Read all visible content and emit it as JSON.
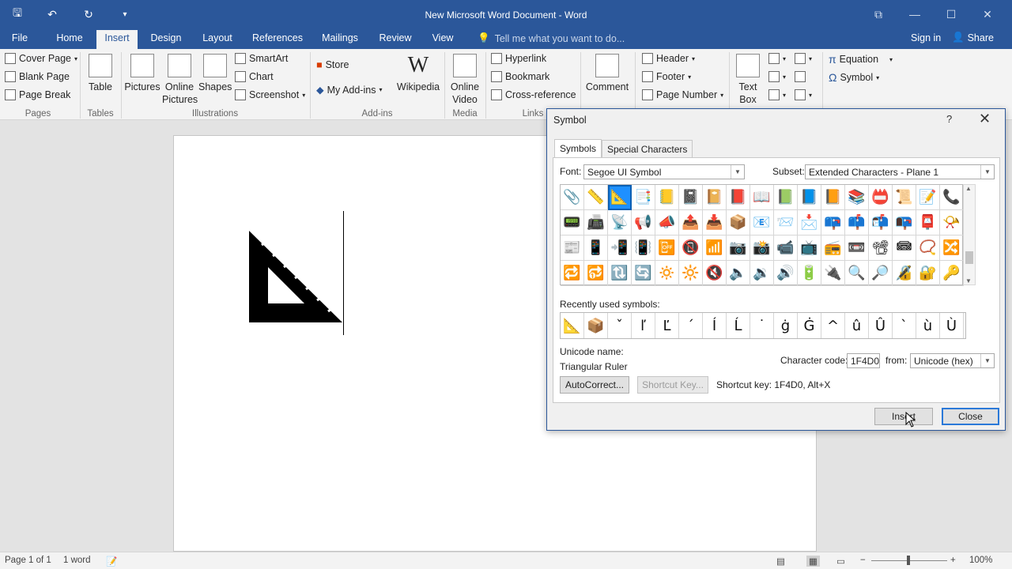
{
  "window": {
    "title": "New Microsoft Word Document - Word"
  },
  "qat": {
    "save_icon": "save-icon",
    "undo_icon": "undo-icon",
    "redo_icon": "redo-icon",
    "save_glyph": "🖫",
    "undo_glyph": "↶",
    "redo_glyph": "↻",
    "customize_glyph": "▾"
  },
  "window_controls": {
    "restore_ribbon": "⧉",
    "minimize": "—",
    "maximize": "☐",
    "close": "✕"
  },
  "menu": {
    "tabs": [
      "File",
      "Home",
      "Insert",
      "Design",
      "Layout",
      "References",
      "Mailings",
      "Review",
      "View"
    ],
    "active": "Insert",
    "tell_me": "Tell me what you want to do...",
    "sign_in": "Sign in",
    "share": "Share"
  },
  "ribbon": {
    "pages": {
      "cover_page": "Cover Page",
      "blank_page": "Blank Page",
      "page_break": "Page Break",
      "group": "Pages"
    },
    "tables": {
      "table": "Table",
      "group": "Tables"
    },
    "illustrations": {
      "pictures": "Pictures",
      "online_pictures_1": "Online",
      "online_pictures_2": "Pictures",
      "shapes": "Shapes",
      "smartart": "SmartArt",
      "chart": "Chart",
      "screenshot": "Screenshot",
      "group": "Illustrations"
    },
    "addins": {
      "store": "Store",
      "my_addins": "My Add-ins",
      "wikipedia": "Wikipedia",
      "group": "Add-ins"
    },
    "media": {
      "online_video_1": "Online",
      "online_video_2": "Video",
      "group": "Media"
    },
    "links": {
      "hyperlink": "Hyperlink",
      "bookmark": "Bookmark",
      "cross_reference": "Cross-reference",
      "group": "Links"
    },
    "comments": {
      "comment": "Comment"
    },
    "header_footer": {
      "header": "Header",
      "footer": "Footer",
      "page_number": "Page Number"
    },
    "text": {
      "text_box_1": "Text",
      "text_box_2": "Box"
    },
    "symbols": {
      "equation": "Equation",
      "symbol": "Symbol"
    }
  },
  "dialog": {
    "title": "Symbol",
    "help": "?",
    "close_glyph": "✕",
    "tabs": [
      "Symbols",
      "Special Characters"
    ],
    "active_tab": "Symbols",
    "font_label": "Font:",
    "font_value": "Segoe UI Symbol",
    "subset_label": "Subset:",
    "subset_value": "Extended Characters - Plane 1",
    "symbols": [
      [
        "📎",
        "📏",
        "📐",
        "📑",
        "📒",
        "📓",
        "📔",
        "📕",
        "📖",
        "📗",
        "📘",
        "📙",
        "📚",
        "📛",
        "📜",
        "📝",
        "📞"
      ],
      [
        "📟",
        "📠",
        "📡",
        "📢",
        "📣",
        "📤",
        "📥",
        "📦",
        "📧",
        "📨",
        "📩",
        "📪",
        "📫",
        "📬",
        "📭",
        "📮",
        "📯"
      ],
      [
        "📰",
        "📱",
        "📲",
        "📳",
        "📴",
        "📵",
        "📶",
        "📷",
        "📸",
        "📹",
        "📺",
        "📻",
        "📼",
        "📽",
        "📾",
        "📿",
        "🔀"
      ],
      [
        "🔁",
        "🔂",
        "🔃",
        "🔄",
        "🔅",
        "🔆",
        "🔇",
        "🔈",
        "🔉",
        "🔊",
        "🔋",
        "🔌",
        "🔍",
        "🔎",
        "🔏",
        "🔐",
        "🔑"
      ]
    ],
    "selected": {
      "row": 0,
      "col": 2
    },
    "recently_used_label": "Recently used symbols:",
    "recent": [
      "📐",
      "📦",
      "ˇ",
      "ľ",
      "Ľ",
      "´",
      "Í",
      "Ĺ",
      "˙",
      "ġ",
      "Ġ",
      "^",
      "û",
      "Û",
      "`",
      "ù",
      "Ù"
    ],
    "unicode_name_label": "Unicode name:",
    "unicode_name": "Triangular Ruler",
    "char_code_label": "Character code:",
    "char_code": "1F4D0",
    "from_label": "from:",
    "from_value": "Unicode (hex)",
    "autocorrect": "AutoCorrect...",
    "shortcut_key_btn": "Shortcut Key...",
    "shortcut_text": "Shortcut key: 1F4D0, Alt+X",
    "insert": "Insert",
    "close": "Close"
  },
  "document": {
    "inserted_symbol": "📐"
  },
  "status": {
    "page": "Page 1 of 1",
    "words": "1 word",
    "zoom": "100%"
  }
}
